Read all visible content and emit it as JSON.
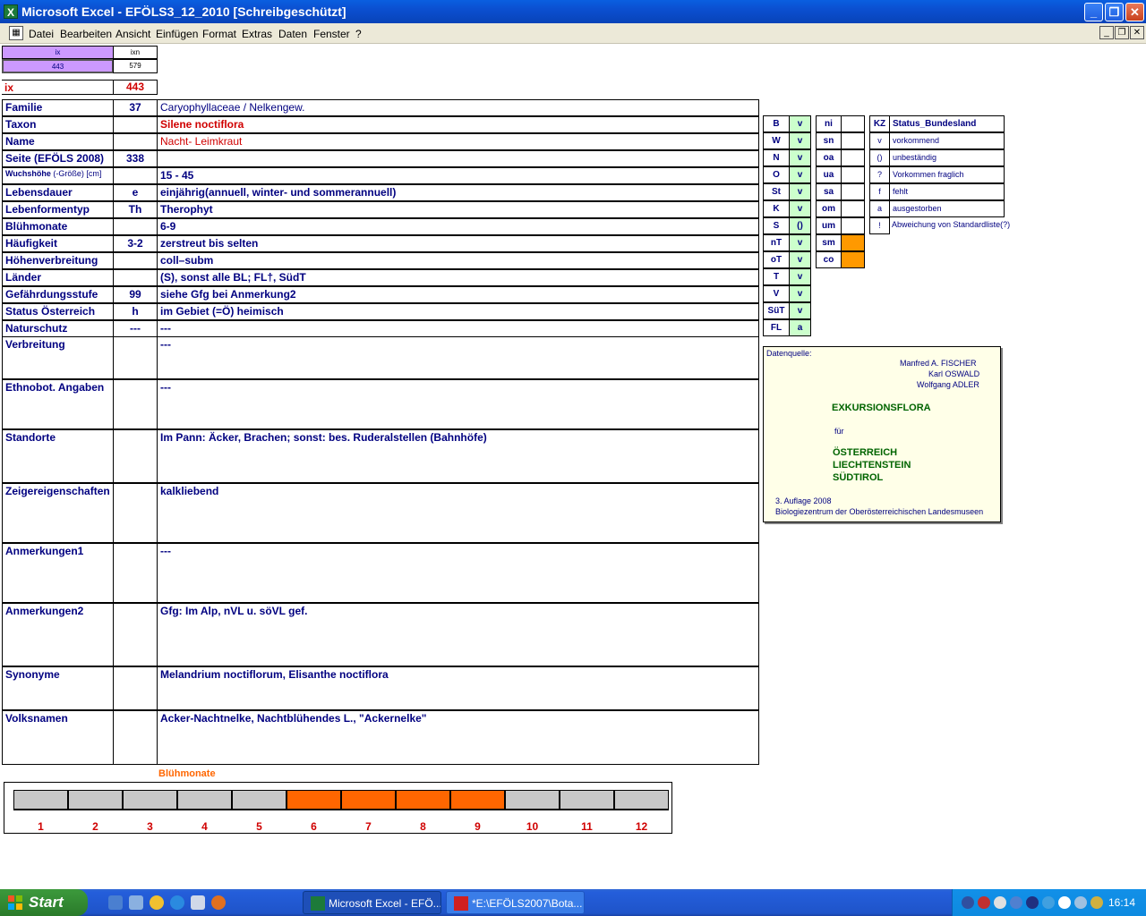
{
  "window": {
    "title": "Microsoft Excel - EFÖLS3_12_2010  [Schreibgeschützt]",
    "app_icon": "X"
  },
  "menu": [
    "Datei",
    "Bearbeiten",
    "Ansicht",
    "Einfügen",
    "Format",
    "Extras",
    "Daten",
    "Fenster",
    "?"
  ],
  "index": {
    "ix_header": "ix",
    "ixn_header": "ixn",
    "ix_value": "443",
    "ixn_value": "579",
    "ix_label": "ix",
    "ix_big": "443"
  },
  "fields": [
    {
      "label": "Familie",
      "code": "37",
      "value": "Caryophyllaceae  /  Nelkengew."
    },
    {
      "label": "Taxon",
      "code": "",
      "value": "Silene noctiflora"
    },
    {
      "label": "Name",
      "code": "",
      "value": "Nacht- Leimkraut"
    },
    {
      "label": "Seite (EFÖLS 2008)",
      "code": "338",
      "value": ""
    },
    {
      "label": "Wuchshöhe",
      "label_suffix": "(-Größe) [cm]",
      "code": "",
      "value": "15 - 45"
    },
    {
      "label": "Lebensdauer",
      "code": "e",
      "value": "einjährig(annuell, winter- und sommerannuell)"
    },
    {
      "label": "Lebenformentyp",
      "code": "Th",
      "value": "Therophyt"
    },
    {
      "label": "Blühmonate",
      "code": "",
      "value": "6-9"
    },
    {
      "label": "Häufigkeit",
      "code": "3-2",
      "value": "zerstreut bis selten"
    },
    {
      "label": "Höhenverbreitung",
      "code": "",
      "value": "coll–subm"
    },
    {
      "label": "Länder",
      "code": "",
      "value": "(S), sonst alle BL; FL†, SüdT"
    },
    {
      "label": "Gefährdungsstufe",
      "code": "99",
      "value": "siehe Gfg bei Anmerkung2"
    },
    {
      "label": "Status Österreich",
      "code": "h",
      "value": "im Gebiet (=Ö) heimisch"
    },
    {
      "label": "Naturschutz",
      "code": "---",
      "value": "---"
    }
  ],
  "tall_fields": [
    {
      "label": "Verbreitung",
      "value": "---"
    },
    {
      "label": "Ethnobot. Angaben",
      "value": "---"
    },
    {
      "label": "Standorte",
      "value": "Im Pann: Äcker, Brachen; sonst: bes. Ruderalstellen (Bahnhöfe)"
    },
    {
      "label": "Zeigereigenschaften",
      "value": " kalkliebend"
    },
    {
      "label": "Anmerkungen1",
      "value": "---"
    },
    {
      "label": "Anmerkungen2",
      "value": "Gfg: Im Alp, nVL u. söVL gef."
    },
    {
      "label": "Synonyme",
      "value": "Melandrium noctiflorum, Elisanthe noctiflora"
    },
    {
      "label": "Volksnamen",
      "value": "Acker-Nachtnelke, Nachtblühendes L., \"Ackernelke\""
    }
  ],
  "states": [
    {
      "code": "B",
      "status": "v"
    },
    {
      "code": "W",
      "status": "v"
    },
    {
      "code": "N",
      "status": "v"
    },
    {
      "code": "O",
      "status": "v"
    },
    {
      "code": "St",
      "status": "v"
    },
    {
      "code": "K",
      "status": "v"
    },
    {
      "code": "S",
      "status": "()"
    },
    {
      "code": "nT",
      "status": "v"
    },
    {
      "code": "oT",
      "status": "v"
    },
    {
      "code": "T",
      "status": "v"
    },
    {
      "code": "V",
      "status": "v"
    },
    {
      "code": "SüT",
      "status": "v"
    },
    {
      "code": "FL",
      "status": "a"
    }
  ],
  "zones": [
    {
      "code": "ni",
      "value": ""
    },
    {
      "code": "sn",
      "value": ""
    },
    {
      "code": "oa",
      "value": ""
    },
    {
      "code": "ua",
      "value": ""
    },
    {
      "code": "sa",
      "value": ""
    },
    {
      "code": "om",
      "value": ""
    },
    {
      "code": "um",
      "value": ""
    },
    {
      "code": "sm",
      "value": "orange"
    },
    {
      "code": "co",
      "value": "orange"
    }
  ],
  "legend": {
    "kz_header": "KZ",
    "status_header": "Status_Bundesland",
    "items": [
      {
        "kz": "v",
        "text": "vorkommend"
      },
      {
        "kz": "()",
        "text": "unbeständig"
      },
      {
        "kz": "?",
        "text": "Vorkommen fraglich"
      },
      {
        "kz": "f",
        "text": "fehlt"
      },
      {
        "kz": "a",
        "text": "ausgestorben"
      },
      {
        "kz": "!",
        "text": "Abweichung von Standardliste(?)"
      }
    ]
  },
  "source": {
    "label": "Datenquelle:",
    "authors": [
      "Manfred A. FISCHER",
      "Karl OSWALD",
      "Wolfgang ADLER"
    ],
    "title": "EXKURSIONSFLORA",
    "fuer": "für",
    "countries": [
      "ÖSTERREICH",
      "LIECHTENSTEIN",
      "SÜDTIROL"
    ],
    "edition": "3. Auflage 2008",
    "publisher": "Biologiezentrum der Oberösterreichischen Landesmuseen"
  },
  "bloom": {
    "title": "Blühmonate",
    "months": [
      "1",
      "2",
      "3",
      "4",
      "5",
      "6",
      "7",
      "8",
      "9",
      "10",
      "11",
      "12"
    ],
    "active": [
      false,
      false,
      false,
      false,
      false,
      true,
      true,
      true,
      true,
      false,
      false,
      false
    ],
    "active_color": "#ff6600",
    "inactive_color": "#c8c8c8"
  },
  "taskbar": {
    "start": "Start",
    "tasks": [
      "Microsoft Excel - EFÖ...",
      "*E:\\EFÖLS2007\\Bota..."
    ],
    "clock": "16:14"
  },
  "colors": {
    "header_purple": "#cc99ff",
    "state_green": "#ccffcc",
    "zone_orange": "#ff9900",
    "label_navy": "#000080",
    "accent_red": "#d00000"
  }
}
